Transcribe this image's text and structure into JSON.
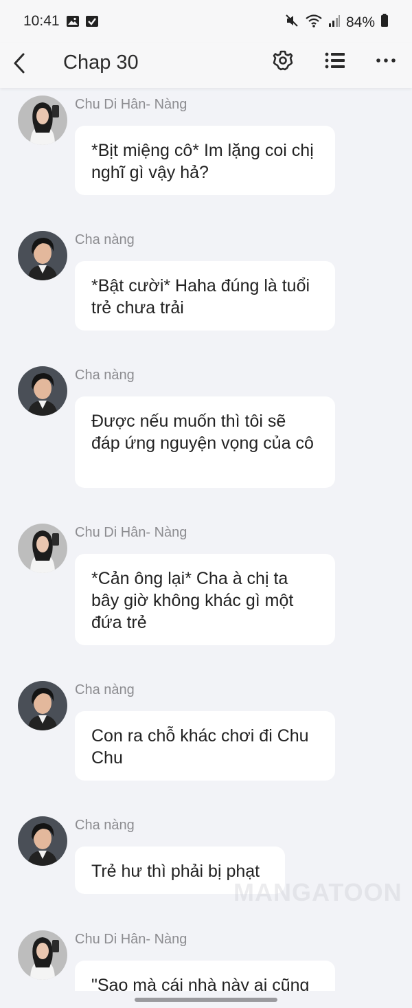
{
  "status_bar": {
    "time": "10:41",
    "battery": "84%",
    "left_icons": [
      "image-icon",
      "check-box-icon"
    ],
    "right_icons": [
      "mute-icon",
      "wifi-icon",
      "signal-icon",
      "battery-icon"
    ]
  },
  "header": {
    "title": "Chap 30",
    "icons": [
      "back-arrow-icon",
      "gear-icon",
      "list-icon",
      "more-icon"
    ]
  },
  "messages": [
    {
      "sender": "Chu Di Hân- Nàng",
      "text": "*Bịt miệng cô* Im lặng coi chị nghĩ gì vậy hả?",
      "avatar": "female"
    },
    {
      "sender": "Cha nàng",
      "text": "*Bật cười* Haha đúng là tuổi trẻ chưa trải",
      "avatar": "male"
    },
    {
      "sender": "Cha nàng",
      "text": "Được nếu muốn thì tôi sẽ đáp ứng nguyện vọng của cô",
      "avatar": "male"
    },
    {
      "sender": "Chu Di Hân- Nàng",
      "text": "*Cản ông lại* Cha à chị ta bây giờ không khác gì một đứa trẻ",
      "avatar": "female"
    },
    {
      "sender": "Cha nàng",
      "text": "Con ra chỗ khác chơi đi Chu Chu",
      "avatar": "male"
    },
    {
      "sender": "Cha nàng",
      "text": "Trẻ hư thì phải bị phạt",
      "avatar": "male"
    },
    {
      "sender": "Chu Di Hân- Nàng",
      "text": "\"Sao mà cái nhà này ai cũng",
      "avatar": "female"
    }
  ],
  "watermark": "MANGATOON",
  "colors": {
    "background": "#f2f3f7",
    "bubble": "#ffffff",
    "sender": "#8c8c90"
  }
}
